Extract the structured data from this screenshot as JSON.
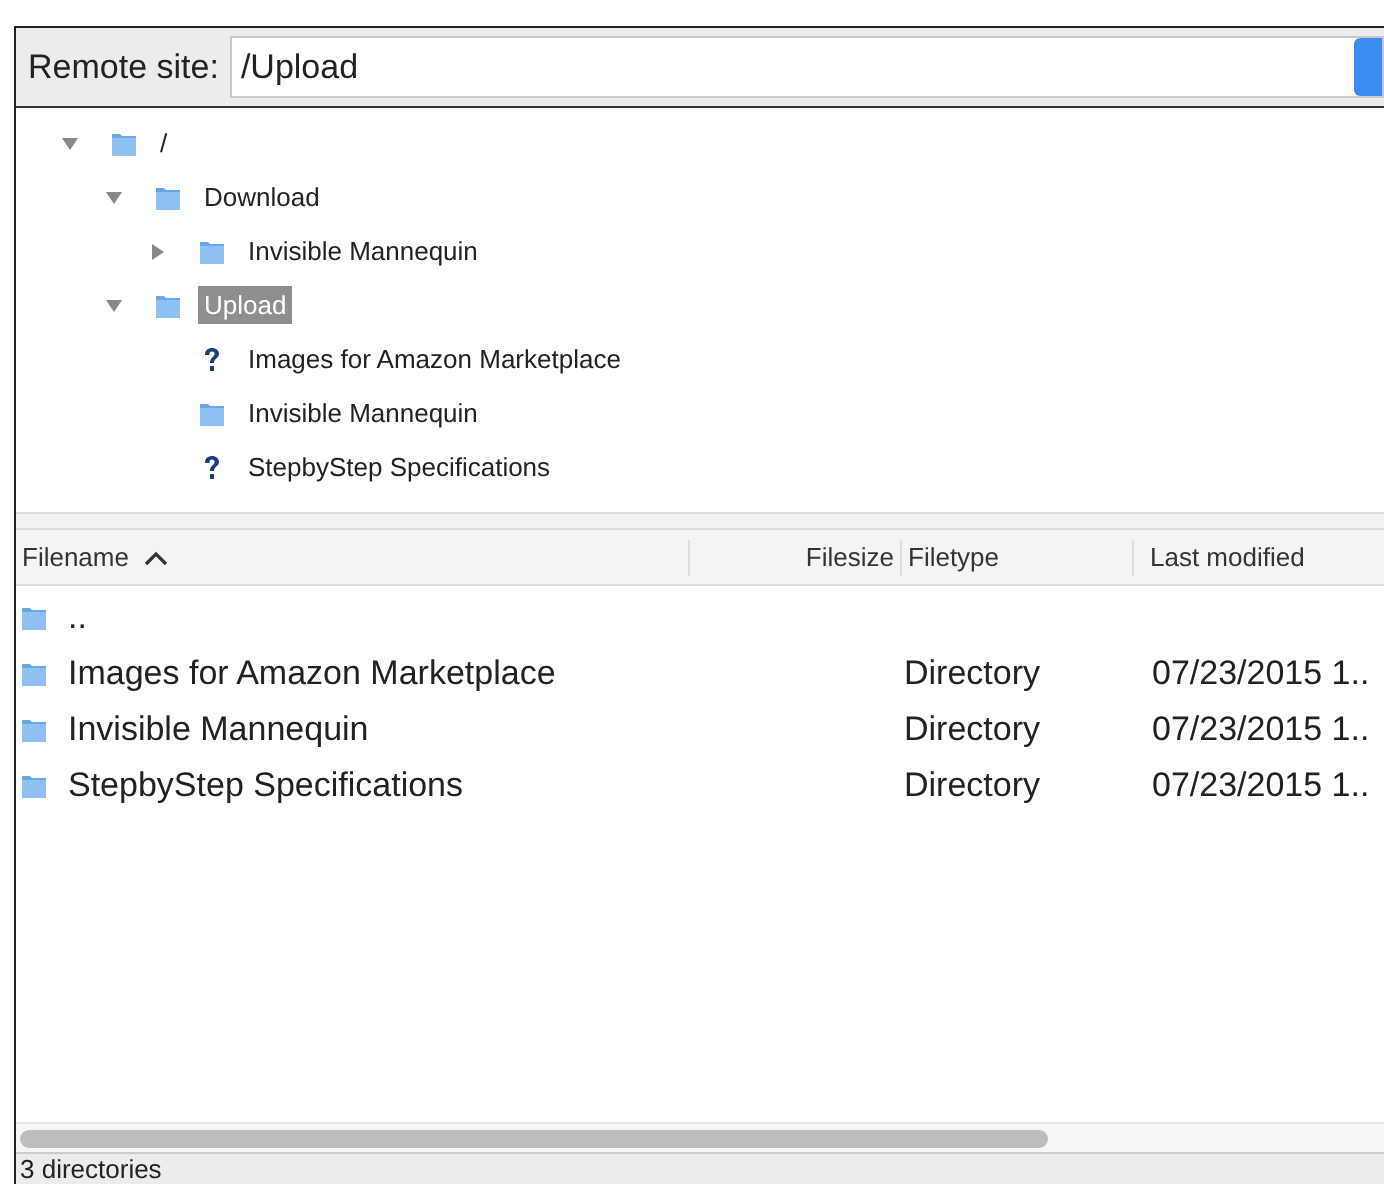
{
  "remote_site": {
    "label": "Remote site:",
    "value": "/Upload"
  },
  "tree": [
    {
      "name": "/",
      "kind": "folder",
      "expanded": true,
      "selected": false,
      "children": [
        {
          "name": "Download",
          "kind": "folder",
          "expanded": true,
          "selected": false,
          "children": [
            {
              "name": "Invisible Mannequin",
              "kind": "folder",
              "expanded": false,
              "selected": false
            }
          ]
        },
        {
          "name": "Upload",
          "kind": "folder",
          "expanded": true,
          "selected": true,
          "children": [
            {
              "name": "Images for Amazon Marketplace",
              "kind": "unknown",
              "selected": false
            },
            {
              "name": "Invisible Mannequin",
              "kind": "folder",
              "selected": false
            },
            {
              "name": "StepbyStep Specifications",
              "kind": "unknown",
              "selected": false
            }
          ]
        }
      ]
    }
  ],
  "table": {
    "columns": [
      {
        "label": "Filename",
        "sorted": true
      },
      {
        "label": "Filesize",
        "sorted": false
      },
      {
        "label": "Filetype",
        "sorted": false
      },
      {
        "label": "Last modified",
        "sorted": false
      }
    ],
    "rows": [
      {
        "filename": ".."
      },
      {
        "filename": "Images for Amazon Marketplace",
        "filetype": "Directory",
        "last_modified": "07/23/2015 1.."
      },
      {
        "filename": "Invisible Mannequin",
        "filetype": "Directory",
        "last_modified": "07/23/2015 1.."
      },
      {
        "filename": "StepbyStep Specifications",
        "filetype": "Directory",
        "last_modified": "07/23/2015 1.."
      }
    ]
  },
  "status_bar": "3 directories"
}
